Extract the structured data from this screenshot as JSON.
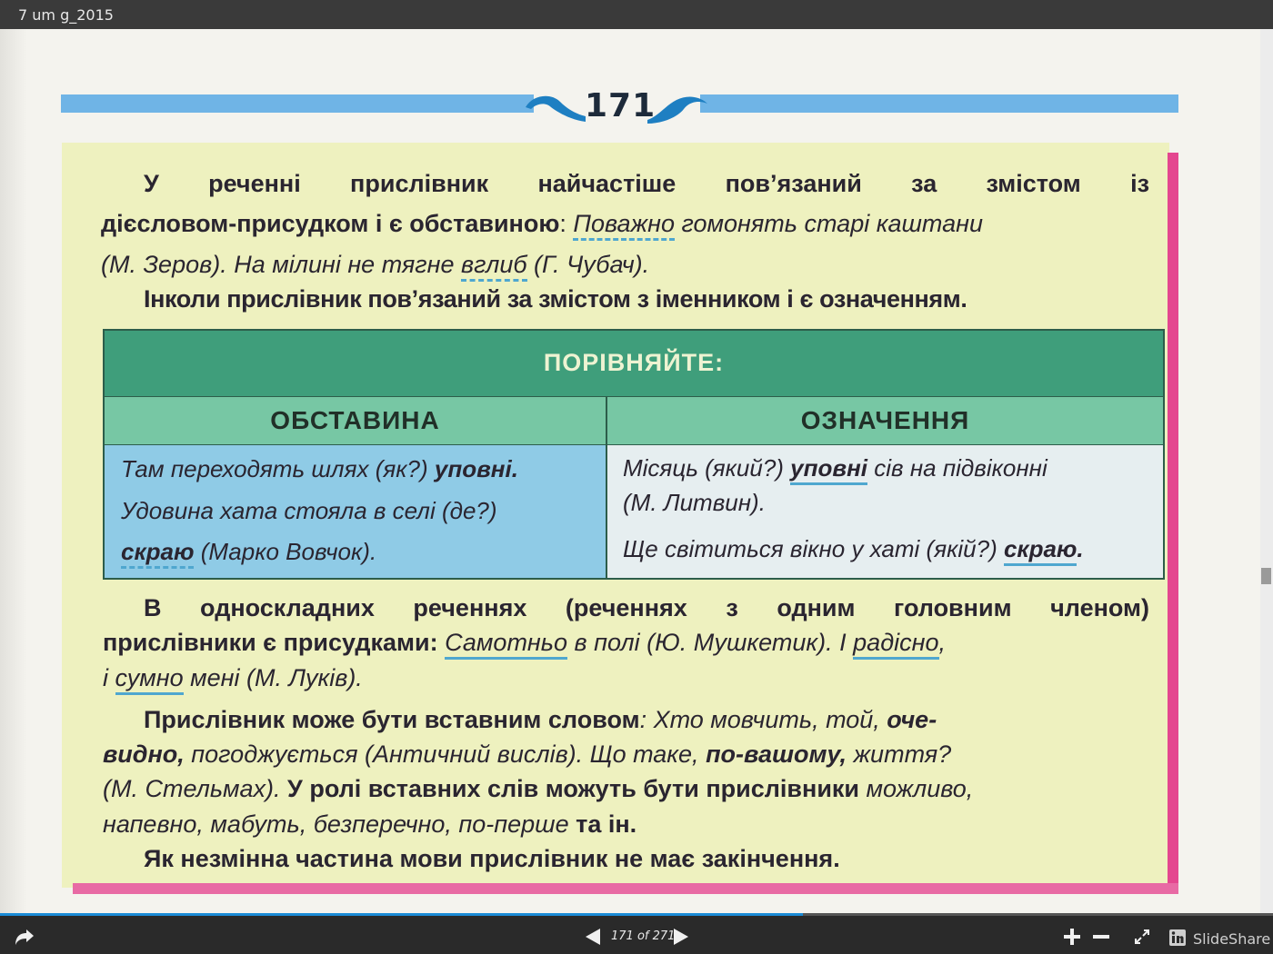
{
  "window": {
    "title": "7 um g_2015"
  },
  "page": {
    "number": "171",
    "p1": {
      "line1_bold": "У реченні прислівник найчастіше пов’язаний за змістом із",
      "line2_bold": "дієсловом-присудком і є обставиною",
      "line2_colon": ": ",
      "line2_ex_u": "Поважно",
      "line2_ex_rest": " гомонять старі каштани",
      "line3_a": "(М. Зеров). На мілині не тягне ",
      "line3_u": "вглиб",
      "line3_b": " (Г. Чубач)."
    },
    "p2": "Інколи прислівник пов’язаний за змістом з іменником і є означенням.",
    "table": {
      "header": "ПОРІВНЯЙТЕ:",
      "col1": "ОБСТАВИНА",
      "col2": "ОЗНАЧЕННЯ",
      "left_l1a": "Там переходять шлях (як?) ",
      "left_l1b": "уповні.",
      "left_l2": "Удовина хата стояла в селі (де?)",
      "left_l3a": "скраю",
      "left_l3b": " (Марко Вовчок).",
      "right_l1a": "Місяць (який?) ",
      "right_l1b": "уповні",
      "right_l1c": " сів на підвіконні",
      "right_l2": "(М. Литвин).",
      "right_l3a": "Ще світиться вікно у хаті (якій?) ",
      "right_l3b": "скраю",
      "right_l3c": "."
    },
    "p3": {
      "line1": "В односкладних реченнях (реченнях з одним головним членом)",
      "line2_bold": "прислівники є присудками: ",
      "line2_u1": "Самотньо",
      "line2_mid": " в полі (Ю. Мушкетик). І ",
      "line2_u2": "радісно",
      "line2_end": ",",
      "line3_a": "і ",
      "line3_u": "сумно",
      "line3_b": " мені (М. Луків)."
    },
    "p4": {
      "line1_bold": "Прислівник може бути вставним словом",
      "line1_rest": ": Хто мовчить, той, ",
      "line1_end_bold": "оче-",
      "line2_bold1": "видно,",
      "line2_mid": " погоджується (Античний вислів). Що таке, ",
      "line2_bold2": "по-вашому,",
      "line2_end": " життя?",
      "line3_a": "(М. Стельмах). ",
      "line3_bold": "У ролі вставних слів можуть бути прислівники",
      "line3_end": " можливо,",
      "line4_a": "напевно, мабуть, безперечно, по-перше ",
      "line4_bold": "та ін."
    },
    "p5": "Як незмінна частина мови прислівник не має закінчення."
  },
  "toolbar": {
    "counter": "171 of 271",
    "brand": "SlideShare",
    "progress": 0.631
  },
  "colors": {
    "accent_blue": "#6fb4e6",
    "pink": "#e4478f",
    "table_head": "#3f9e7b"
  }
}
